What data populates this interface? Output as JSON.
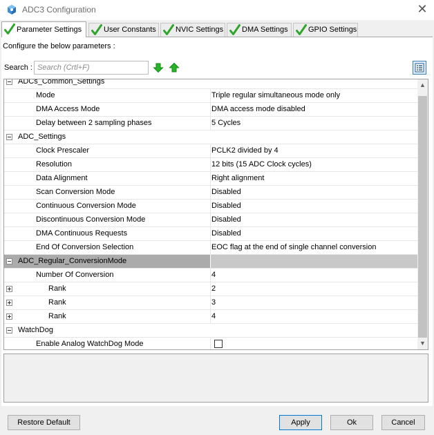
{
  "window": {
    "title": "ADC3 Configuration",
    "close_glyph": "✕"
  },
  "tabs": [
    {
      "label": "Parameter Settings",
      "active": true
    },
    {
      "label": "User Constants",
      "active": false
    },
    {
      "label": "NVIC Settings",
      "active": false
    },
    {
      "label": "DMA Settings",
      "active": false
    },
    {
      "label": "GPIO Settings",
      "active": false
    }
  ],
  "header": {
    "configure_label": "Configure the below parameters :"
  },
  "search": {
    "label": "Search :",
    "placeholder": "Search (Crtl+F)",
    "value": ""
  },
  "groups": {
    "common": {
      "name": "ADCs_Common_Settings",
      "rows": [
        {
          "name": "Mode",
          "value": "Triple regular simultaneous mode only"
        },
        {
          "name": "DMA Access Mode",
          "value": "DMA access mode disabled"
        },
        {
          "name": "Delay between 2 sampling phases",
          "value": "5 Cycles"
        }
      ]
    },
    "adc": {
      "name": "ADC_Settings",
      "rows": [
        {
          "name": "Clock Prescaler",
          "value": "PCLK2 divided by 4"
        },
        {
          "name": "Resolution",
          "value": "12 bits (15 ADC Clock cycles)"
        },
        {
          "name": "Data Alignment",
          "value": "Right alignment"
        },
        {
          "name": "Scan Conversion Mode",
          "value": "Disabled"
        },
        {
          "name": "Continuous Conversion Mode",
          "value": "Disabled"
        },
        {
          "name": "Discontinuous Conversion Mode",
          "value": "Disabled"
        },
        {
          "name": "DMA Continuous Requests",
          "value": "Disabled"
        },
        {
          "name": "End Of Conversion Selection",
          "value": "EOC flag at the end of single channel conversion"
        }
      ]
    },
    "regular": {
      "name": "ADC_Regular_ConversionMode",
      "number_of_conversion": {
        "name": "Number Of Conversion",
        "value": "4"
      },
      "ranks": [
        {
          "name": "Rank",
          "value": "2"
        },
        {
          "name": "Rank",
          "value": "3"
        },
        {
          "name": "Rank",
          "value": "4"
        }
      ]
    },
    "watchdog": {
      "name": "WatchDog",
      "rows": [
        {
          "name": "Enable Analog WatchDog Mode",
          "checked": false
        }
      ]
    }
  },
  "buttons": {
    "restore": "Restore Default",
    "apply": "Apply",
    "ok": "Ok",
    "cancel": "Cancel"
  },
  "colors": {
    "check_green": "#2fa52f",
    "arrow_green": "#26b526",
    "selected_group": "#ababab",
    "accent_blue": "#0078d7"
  },
  "icons": {
    "app": "cube-icon",
    "tab": "checkmark-icon",
    "search_next": "arrow-down-icon",
    "search_prev": "arrow-up-icon",
    "view": "list-view-icon"
  }
}
